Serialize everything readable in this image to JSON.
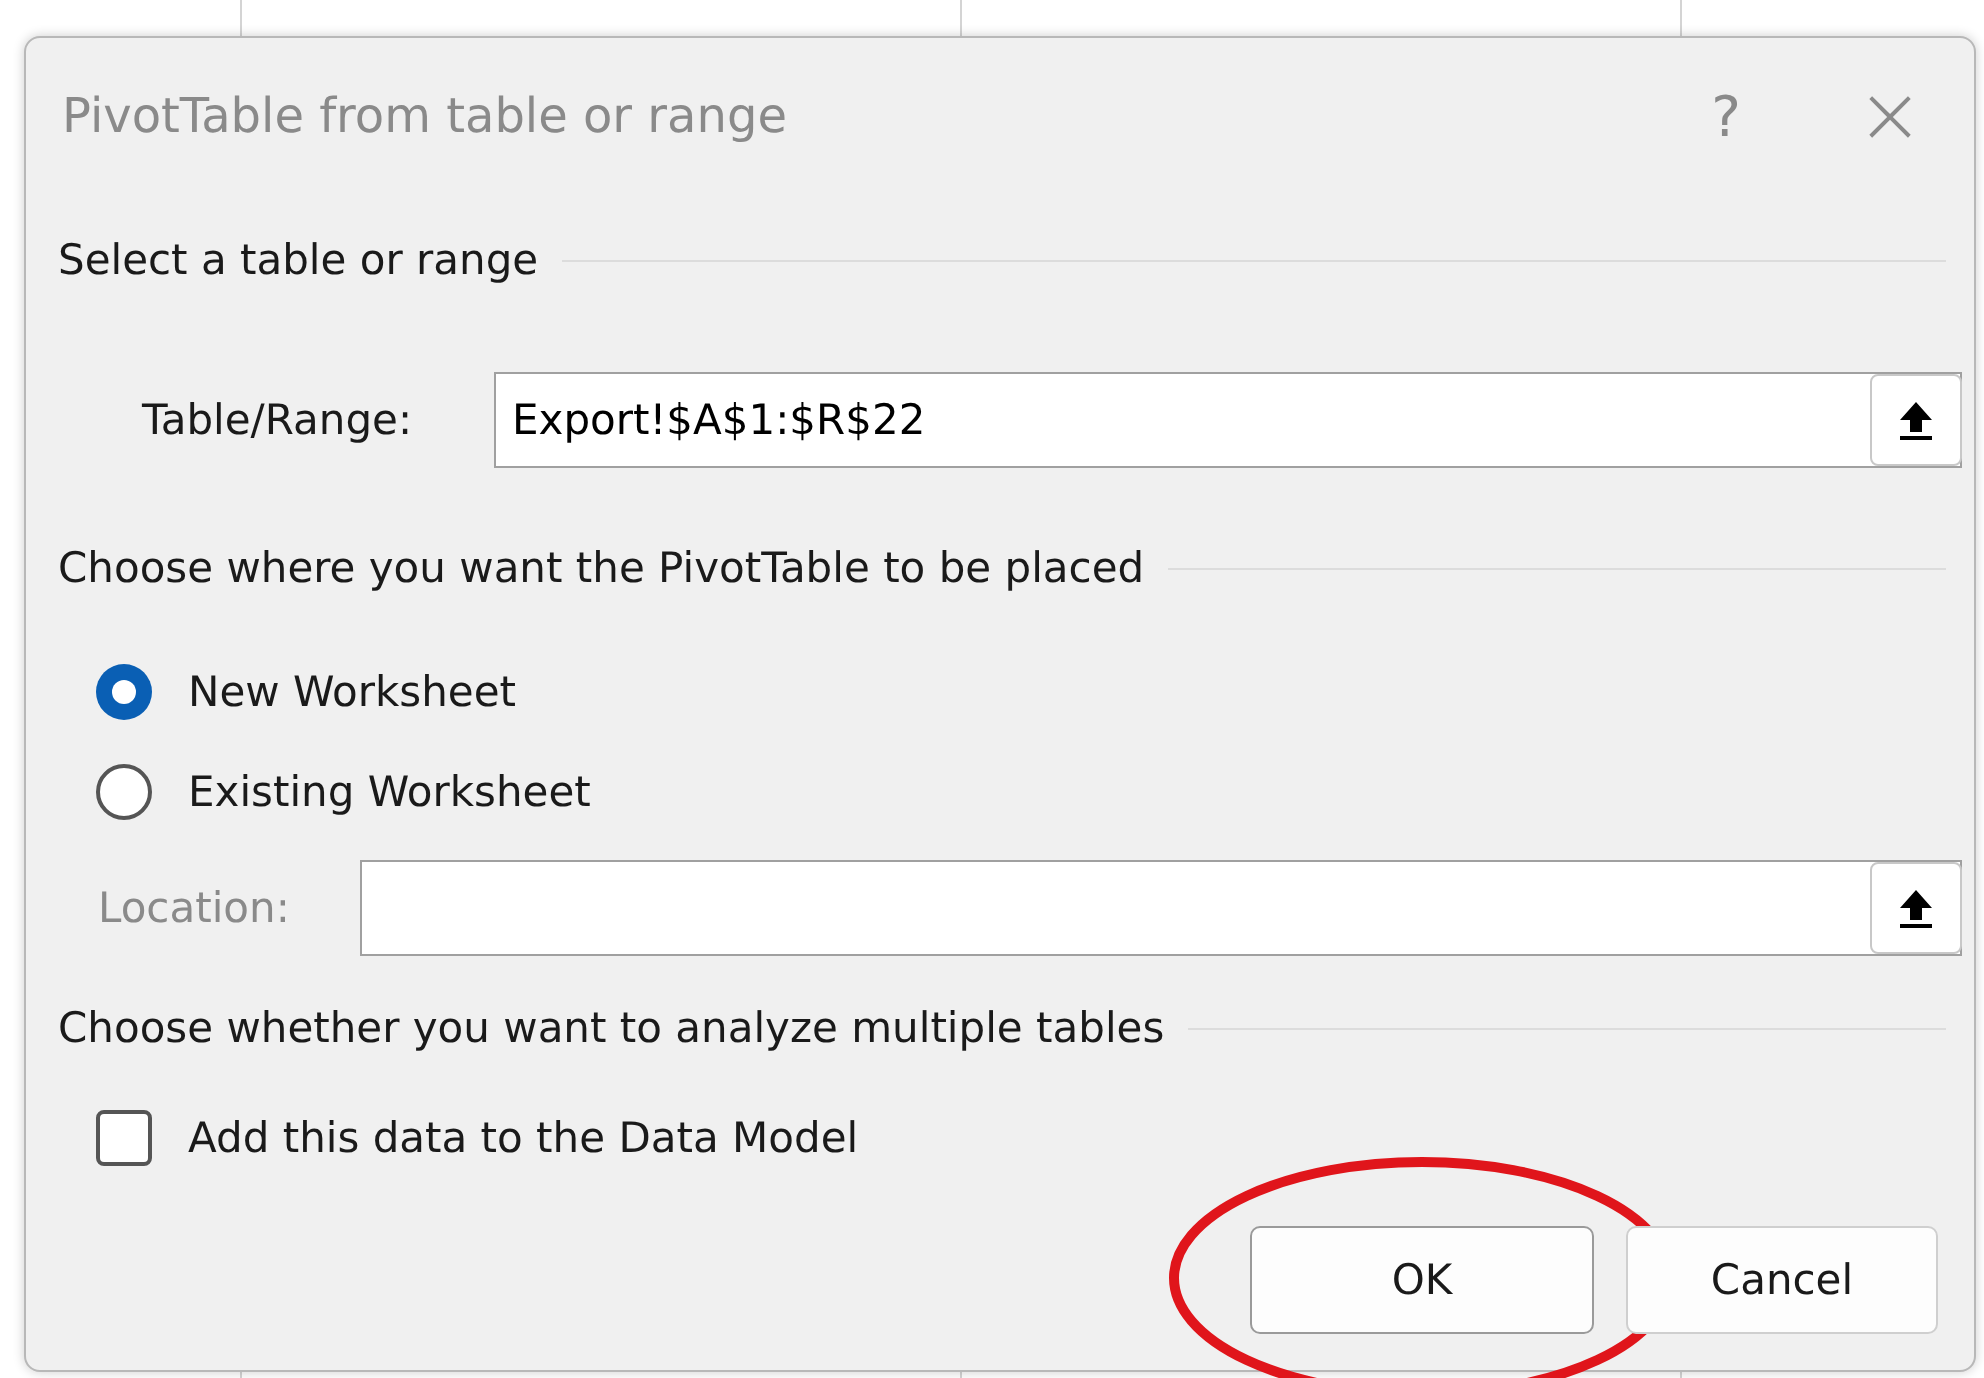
{
  "window": {
    "title": "PivotTable from table or range",
    "help": "?",
    "close": "×"
  },
  "source": {
    "heading": "Select a table or range",
    "label": "Table/Range:",
    "value": "Export!$A$1:$R$22"
  },
  "placement": {
    "heading": "Choose where you want the PivotTable to be placed",
    "options": [
      {
        "label": "New Worksheet",
        "selected": true
      },
      {
        "label": "Existing Worksheet",
        "selected": false
      }
    ],
    "location": {
      "label": "Location:",
      "disabled": true
    }
  },
  "multiple": {
    "heading": "Choose whether you want to analyze multiple tables",
    "checkbox": {
      "label": "Add this data to the Data Model",
      "checked": false
    }
  },
  "buttons": [
    {
      "label": "OK",
      "highlighted": true
    },
    {
      "label": "Cancel",
      "highlighted": false
    }
  ]
}
